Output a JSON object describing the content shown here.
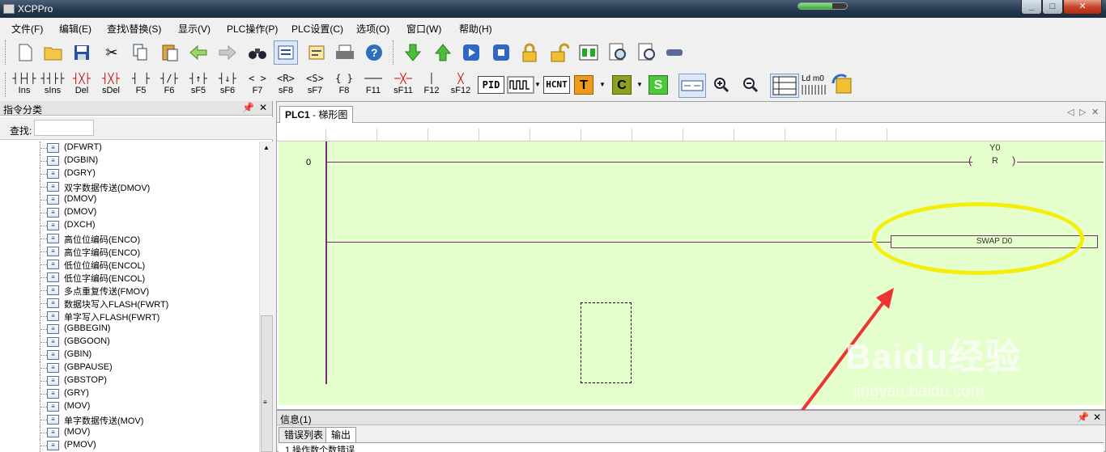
{
  "window": {
    "title": "XCPPro",
    "progress": 0.7
  },
  "menu": [
    "文件(F)",
    "编辑(E)",
    "查找\\替换(S)",
    "显示(V)",
    "PLC操作(P)",
    "PLC设置(C)",
    "选项(O)",
    "窗口(W)",
    "帮助(H)"
  ],
  "ladder_toolbar": {
    "keys": [
      {
        "sym": "┤├┤├",
        "label": "Ins"
      },
      {
        "sym": "┤┤├├",
        "label": "sIns"
      },
      {
        "sym": "┤╳├",
        "label": "Del"
      },
      {
        "sym": "┤╳├",
        "label": "sDel"
      },
      {
        "sym": "┤ ├",
        "label": "F5"
      },
      {
        "sym": "┤/├",
        "label": "F6"
      },
      {
        "sym": "┤↑├",
        "label": "sF5"
      },
      {
        "sym": "┤↓├",
        "label": "sF6"
      },
      {
        "sym": "< >",
        "label": "F7"
      },
      {
        "sym": "<R>",
        "label": "sF8"
      },
      {
        "sym": "<S>",
        "label": "sF7"
      },
      {
        "sym": "{ }",
        "label": "F8"
      },
      {
        "sym": "───",
        "label": "F11"
      },
      {
        "sym": "─╳─",
        "label": "sF11"
      },
      {
        "sym": "│",
        "label": "F12"
      },
      {
        "sym": "╳",
        "label": "sF12"
      }
    ],
    "pid": "PID",
    "hcnt": "HCNT",
    "t": "T",
    "c": "C",
    "s": "S",
    "ldm0": "Ld m0"
  },
  "left_panel": {
    "title": "指令分类",
    "search_label": "查找:",
    "search_value": "",
    "items": [
      "(DFWRT)",
      "(DGBIN)",
      "(DGRY)",
      "双字数据传送(DMOV)",
      "(DMOV)",
      "(DMOV)",
      "(DXCH)",
      "高位位编码(ENCO)",
      "高位字编码(ENCO)",
      "低位位编码(ENCOL)",
      "低位字编码(ENCOL)",
      "多点重复传送(FMOV)",
      "数据块写入FLASH(FWRT)",
      "单字写入FLASH(FWRT)",
      "(GBBEGIN)",
      "(GBGOON)",
      "(GBIN)",
      "(GBPAUSE)",
      "(GBSTOP)",
      "(GRY)",
      "(MOV)",
      "单字数据传送(MOV)",
      "(MOV)",
      "(PMOV)"
    ]
  },
  "document": {
    "tab_title": "PLC1",
    "tab_subtitle": " - 梯形图",
    "rung_number": "0",
    "coil_name": "Y0",
    "coil_type": "R",
    "instruction": "SWAP   D0"
  },
  "watermark": {
    "brand": "Baidu经验",
    "url": "jingyan.baidu.com"
  },
  "output_panel": {
    "title": "信息(1)",
    "tabs": [
      "错误列表",
      "输出"
    ],
    "active_tab": 1,
    "body": "1 操作数个数错误"
  },
  "colors": {
    "ladder_bg": "#e4fecc",
    "wire": "#7a2a7a",
    "highlight": "#f5ee0a",
    "arrow": "#ee3333"
  }
}
